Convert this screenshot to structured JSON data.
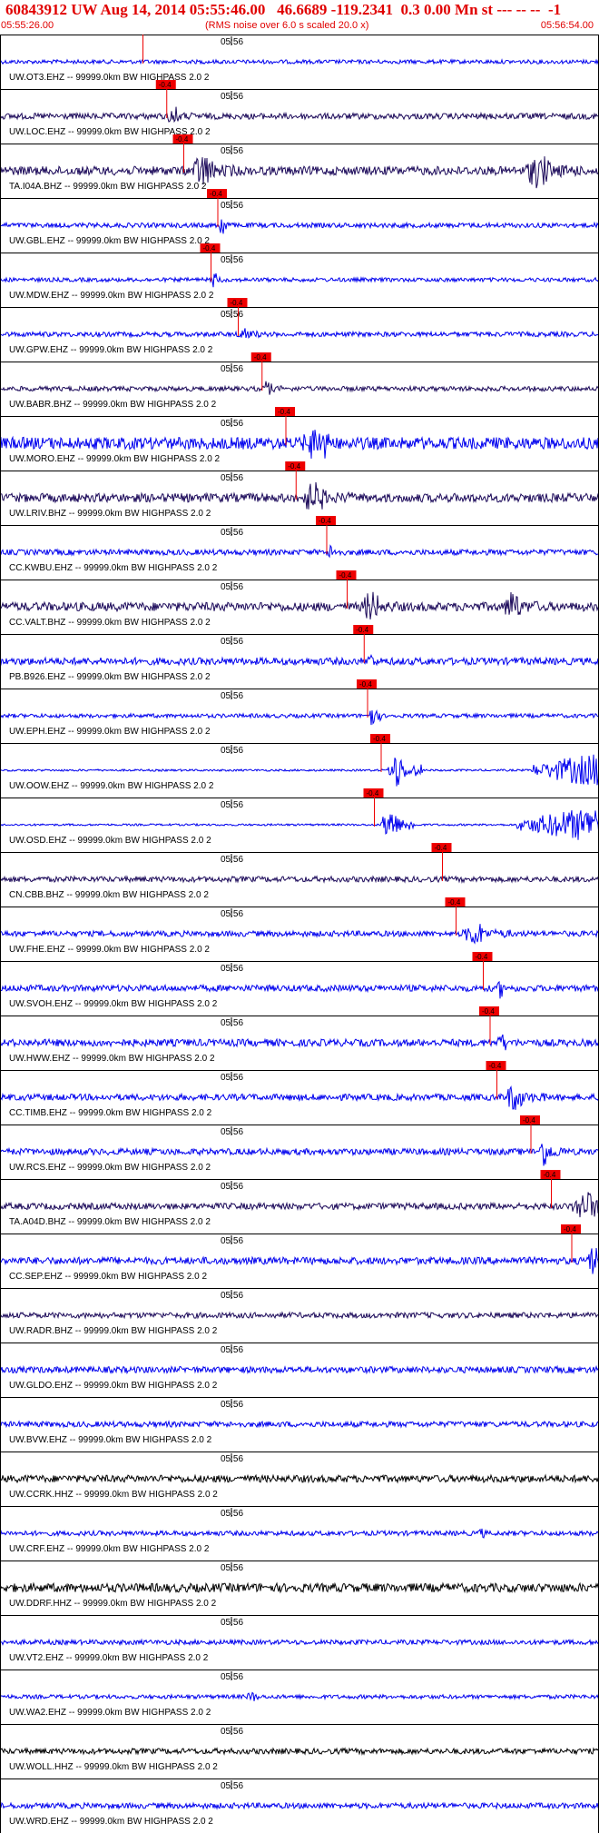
{
  "header": {
    "title": "60843912 UW Aug 14, 2014 05:55:46.00   46.6689 -119.2341  0.3 0.00 Mn st --- -- --  -1",
    "start_time": "05:55:26.00",
    "end_time": "05:56:54.00",
    "rms_note": "(RMS noise over 6.0 s scaled 20.0 x)"
  },
  "chart_data": {
    "type": "seismogram_record_section",
    "x_range_seconds": [
      0,
      88
    ],
    "minute_label": "05:56",
    "minute_mark_seconds": 34,
    "pick_label": "-0.4",
    "colors": {
      "blue": "#0000ee",
      "navy": "#1c0a5a",
      "black": "#000000",
      "pick": "#ee0000"
    },
    "traces": [
      {
        "label": "UW.OT3.EHZ -- 99999.0km BW  HIGHPASS  2.0  2",
        "pick_s": 21.0,
        "color": "blue",
        "amp": 0.1,
        "bursts": []
      },
      {
        "label": "UW.LOC.EHZ -- 99999.0km BW  HIGHPASS  2.0  2",
        "pick_s": 24.5,
        "color": "navy",
        "amp": 0.15,
        "bursts": [
          [
            24.5,
            4,
            0.6
          ]
        ]
      },
      {
        "label": "TA.I04A.BHZ -- 99999.0km BW  HIGHPASS  2.0  2",
        "pick_s": 27.0,
        "color": "navy",
        "amp": 0.22,
        "bursts": [
          [
            28,
            7,
            1.0
          ],
          [
            77,
            8,
            1.0
          ]
        ]
      },
      {
        "label": "UW.GBL.EHZ -- 99999.0km BW  HIGHPASS  2.0  2",
        "pick_s": 32.0,
        "color": "blue",
        "amp": 0.12,
        "bursts": [
          [
            32,
            2,
            0.8
          ],
          [
            101,
            1,
            0.7
          ],
          [
            136,
            1,
            0.8
          ]
        ]
      },
      {
        "label": "UW.MDW.EHZ -- 99999.0km BW  HIGHPASS  2.0  2",
        "pick_s": 31.0,
        "color": "blue",
        "amp": 0.1,
        "bursts": [
          [
            31,
            2,
            0.5
          ],
          [
            136,
            1,
            0.6
          ]
        ]
      },
      {
        "label": "UW.GPW.EHZ -- 99999.0km BW  HIGHPASS  2.0  2",
        "pick_s": 35.0,
        "color": "blue",
        "amp": 0.12,
        "bursts": [
          [
            35,
            3,
            0.6
          ]
        ]
      },
      {
        "label": "UW.BABR.BHZ -- 99999.0km BW  HIGHPASS  2.0  2",
        "pick_s": 38.5,
        "color": "navy",
        "amp": 0.12,
        "bursts": [
          [
            38.5,
            3,
            0.5
          ]
        ]
      },
      {
        "label": "UW.MORO.EHZ -- 99999.0km BW  HIGHPASS  2.0  2",
        "pick_s": 42.0,
        "color": "blue",
        "amp": 0.3,
        "bursts": [
          [
            44,
            10,
            1.0
          ]
        ]
      },
      {
        "label": "UW.LRIV.BHZ -- 99999.0km BW  HIGHPASS  2.0  2",
        "pick_s": 43.5,
        "color": "navy",
        "amp": 0.22,
        "bursts": [
          [
            44,
            8,
            0.9
          ]
        ]
      },
      {
        "label": "CC.KWBU.EHZ -- 99999.0km BW  HIGHPASS  2.0  2",
        "pick_s": 48.0,
        "color": "blue",
        "amp": 0.14,
        "bursts": [
          [
            48,
            3,
            0.5
          ],
          [
            113,
            6,
            0.6
          ]
        ]
      },
      {
        "label": "CC.VALT.BHZ -- 99999.0km BW  HIGHPASS  2.0  2",
        "pick_s": 51.0,
        "color": "navy",
        "amp": 0.22,
        "bursts": [
          [
            53,
            6,
            0.9
          ],
          [
            74,
            5,
            1.0
          ]
        ]
      },
      {
        "label": "PB.B926.EHZ -- 99999.0km BW  HIGHPASS  2.0  2",
        "pick_s": 53.5,
        "color": "blue",
        "amp": 0.18,
        "bursts": [
          [
            54,
            2,
            0.6
          ]
        ]
      },
      {
        "label": "UW.EPH.EHZ -- 99999.0km BW  HIGHPASS  2.0  2",
        "pick_s": 54.0,
        "color": "blue",
        "amp": 0.1,
        "bursts": [
          [
            54,
            2,
            0.8
          ]
        ]
      },
      {
        "label": "UW.OOW.EHZ -- 99999.0km BW  HIGHPASS  2.0  2",
        "pick_s": 56.0,
        "color": "blue",
        "amp": 0.05,
        "bursts": [
          [
            57,
            5,
            1.0
          ],
          [
            78,
            50,
            1.0
          ]
        ]
      },
      {
        "label": "UW.OSD.EHZ -- 99999.0km BW  HIGHPASS  2.0  2",
        "pick_s": 55.0,
        "color": "blue",
        "amp": 0.05,
        "bursts": [
          [
            56,
            5,
            1.0
          ],
          [
            76,
            52,
            1.0
          ]
        ]
      },
      {
        "label": "CN.CBB.BHZ -- 99999.0km BW  HIGHPASS  2.0  2",
        "pick_s": 65.0,
        "color": "navy",
        "amp": 0.14,
        "bursts": []
      },
      {
        "label": "UW.FHE.EHZ -- 99999.0km BW  HIGHPASS  2.0  2",
        "pick_s": 67.0,
        "color": "blue",
        "amp": 0.14,
        "bursts": [
          [
            68,
            7,
            0.7
          ]
        ]
      },
      {
        "label": "UW.SVOH.EHZ -- 99999.0km BW  HIGHPASS  2.0  2",
        "pick_s": 71.0,
        "color": "blue",
        "amp": 0.16,
        "bursts": [
          [
            73,
            2,
            0.6
          ]
        ]
      },
      {
        "label": "UW.HWW.EHZ -- 99999.0km BW  HIGHPASS  2.0  2",
        "pick_s": 72.0,
        "color": "blue",
        "amp": 0.18,
        "bursts": [
          [
            73,
            3,
            0.6
          ]
        ]
      },
      {
        "label": "CC.TIMB.EHZ -- 99999.0km BW  HIGHPASS  2.0  2",
        "pick_s": 73.0,
        "color": "blue",
        "amp": 0.16,
        "bursts": [
          [
            74,
            6,
            0.8
          ]
        ]
      },
      {
        "label": "UW.RCS.EHZ -- 99999.0km BW  HIGHPASS  2.0  2",
        "pick_s": 78.0,
        "color": "blue",
        "amp": 0.16,
        "bursts": [
          [
            79,
            4,
            0.9
          ],
          [
            116,
            3,
            0.9
          ],
          [
            132,
            3,
            0.9
          ]
        ]
      },
      {
        "label": "TA.A04D.BHZ -- 99999.0km BW  HIGHPASS  2.0  2",
        "pick_s": 81.0,
        "color": "navy",
        "amp": 0.16,
        "bursts": [
          [
            84,
            8,
            0.9
          ]
        ]
      },
      {
        "label": "CC.SEP.EHZ -- 99999.0km BW  HIGHPASS  2.0  2",
        "pick_s": 84.0,
        "color": "blue",
        "amp": 0.18,
        "bursts": [
          [
            86,
            5,
            0.9
          ]
        ]
      },
      {
        "label": "UW.RADR.BHZ -- 99999.0km BW  HIGHPASS  2.0  2",
        "pick_s": 104.0,
        "color": "navy",
        "amp": 0.14,
        "bursts": []
      },
      {
        "label": "UW.GLDO.EHZ -- 99999.0km BW  HIGHPASS  2.0  2",
        "pick_s": 111.0,
        "color": "blue",
        "amp": 0.16,
        "bursts": [
          [
            114,
            2,
            0.7
          ]
        ]
      },
      {
        "label": "UW.BVW.EHZ -- 99999.0km BW  HIGHPASS  2.0  2",
        "pick_s": null,
        "color": "blue",
        "amp": 0.14,
        "bursts": []
      },
      {
        "label": "UW.CCRK.HHZ -- 99999.0km BW  HIGHPASS  2.0  2",
        "pick_s": null,
        "color": "black",
        "amp": 0.18,
        "bursts": []
      },
      {
        "label": "UW.CRF.EHZ -- 99999.0km BW  HIGHPASS  2.0  2",
        "pick_s": null,
        "color": "blue",
        "amp": 0.12,
        "bursts": [
          [
            70,
            3,
            0.3
          ]
        ]
      },
      {
        "label": "UW.DDRF.HHZ -- 99999.0km BW  HIGHPASS  2.0  2",
        "pick_s": null,
        "color": "black",
        "amp": 0.22,
        "bursts": []
      },
      {
        "label": "UW.VT2.EHZ -- 99999.0km BW  HIGHPASS  2.0  2",
        "pick_s": null,
        "color": "blue",
        "amp": 0.12,
        "bursts": []
      },
      {
        "label": "UW.WA2.EHZ -- 99999.0km BW  HIGHPASS  2.0  2",
        "pick_s": null,
        "color": "blue",
        "amp": 0.1,
        "bursts": [
          [
            36,
            4,
            0.3
          ]
        ]
      },
      {
        "label": "UW.WOLL.HHZ -- 99999.0km BW  HIGHPASS  2.0  2",
        "pick_s": null,
        "color": "black",
        "amp": 0.14,
        "bursts": []
      },
      {
        "label": "UW.WRD.EHZ -- 99999.0km BW  HIGHPASS  2.0  2",
        "pick_s": null,
        "color": "blue",
        "amp": 0.14,
        "bursts": []
      }
    ]
  }
}
